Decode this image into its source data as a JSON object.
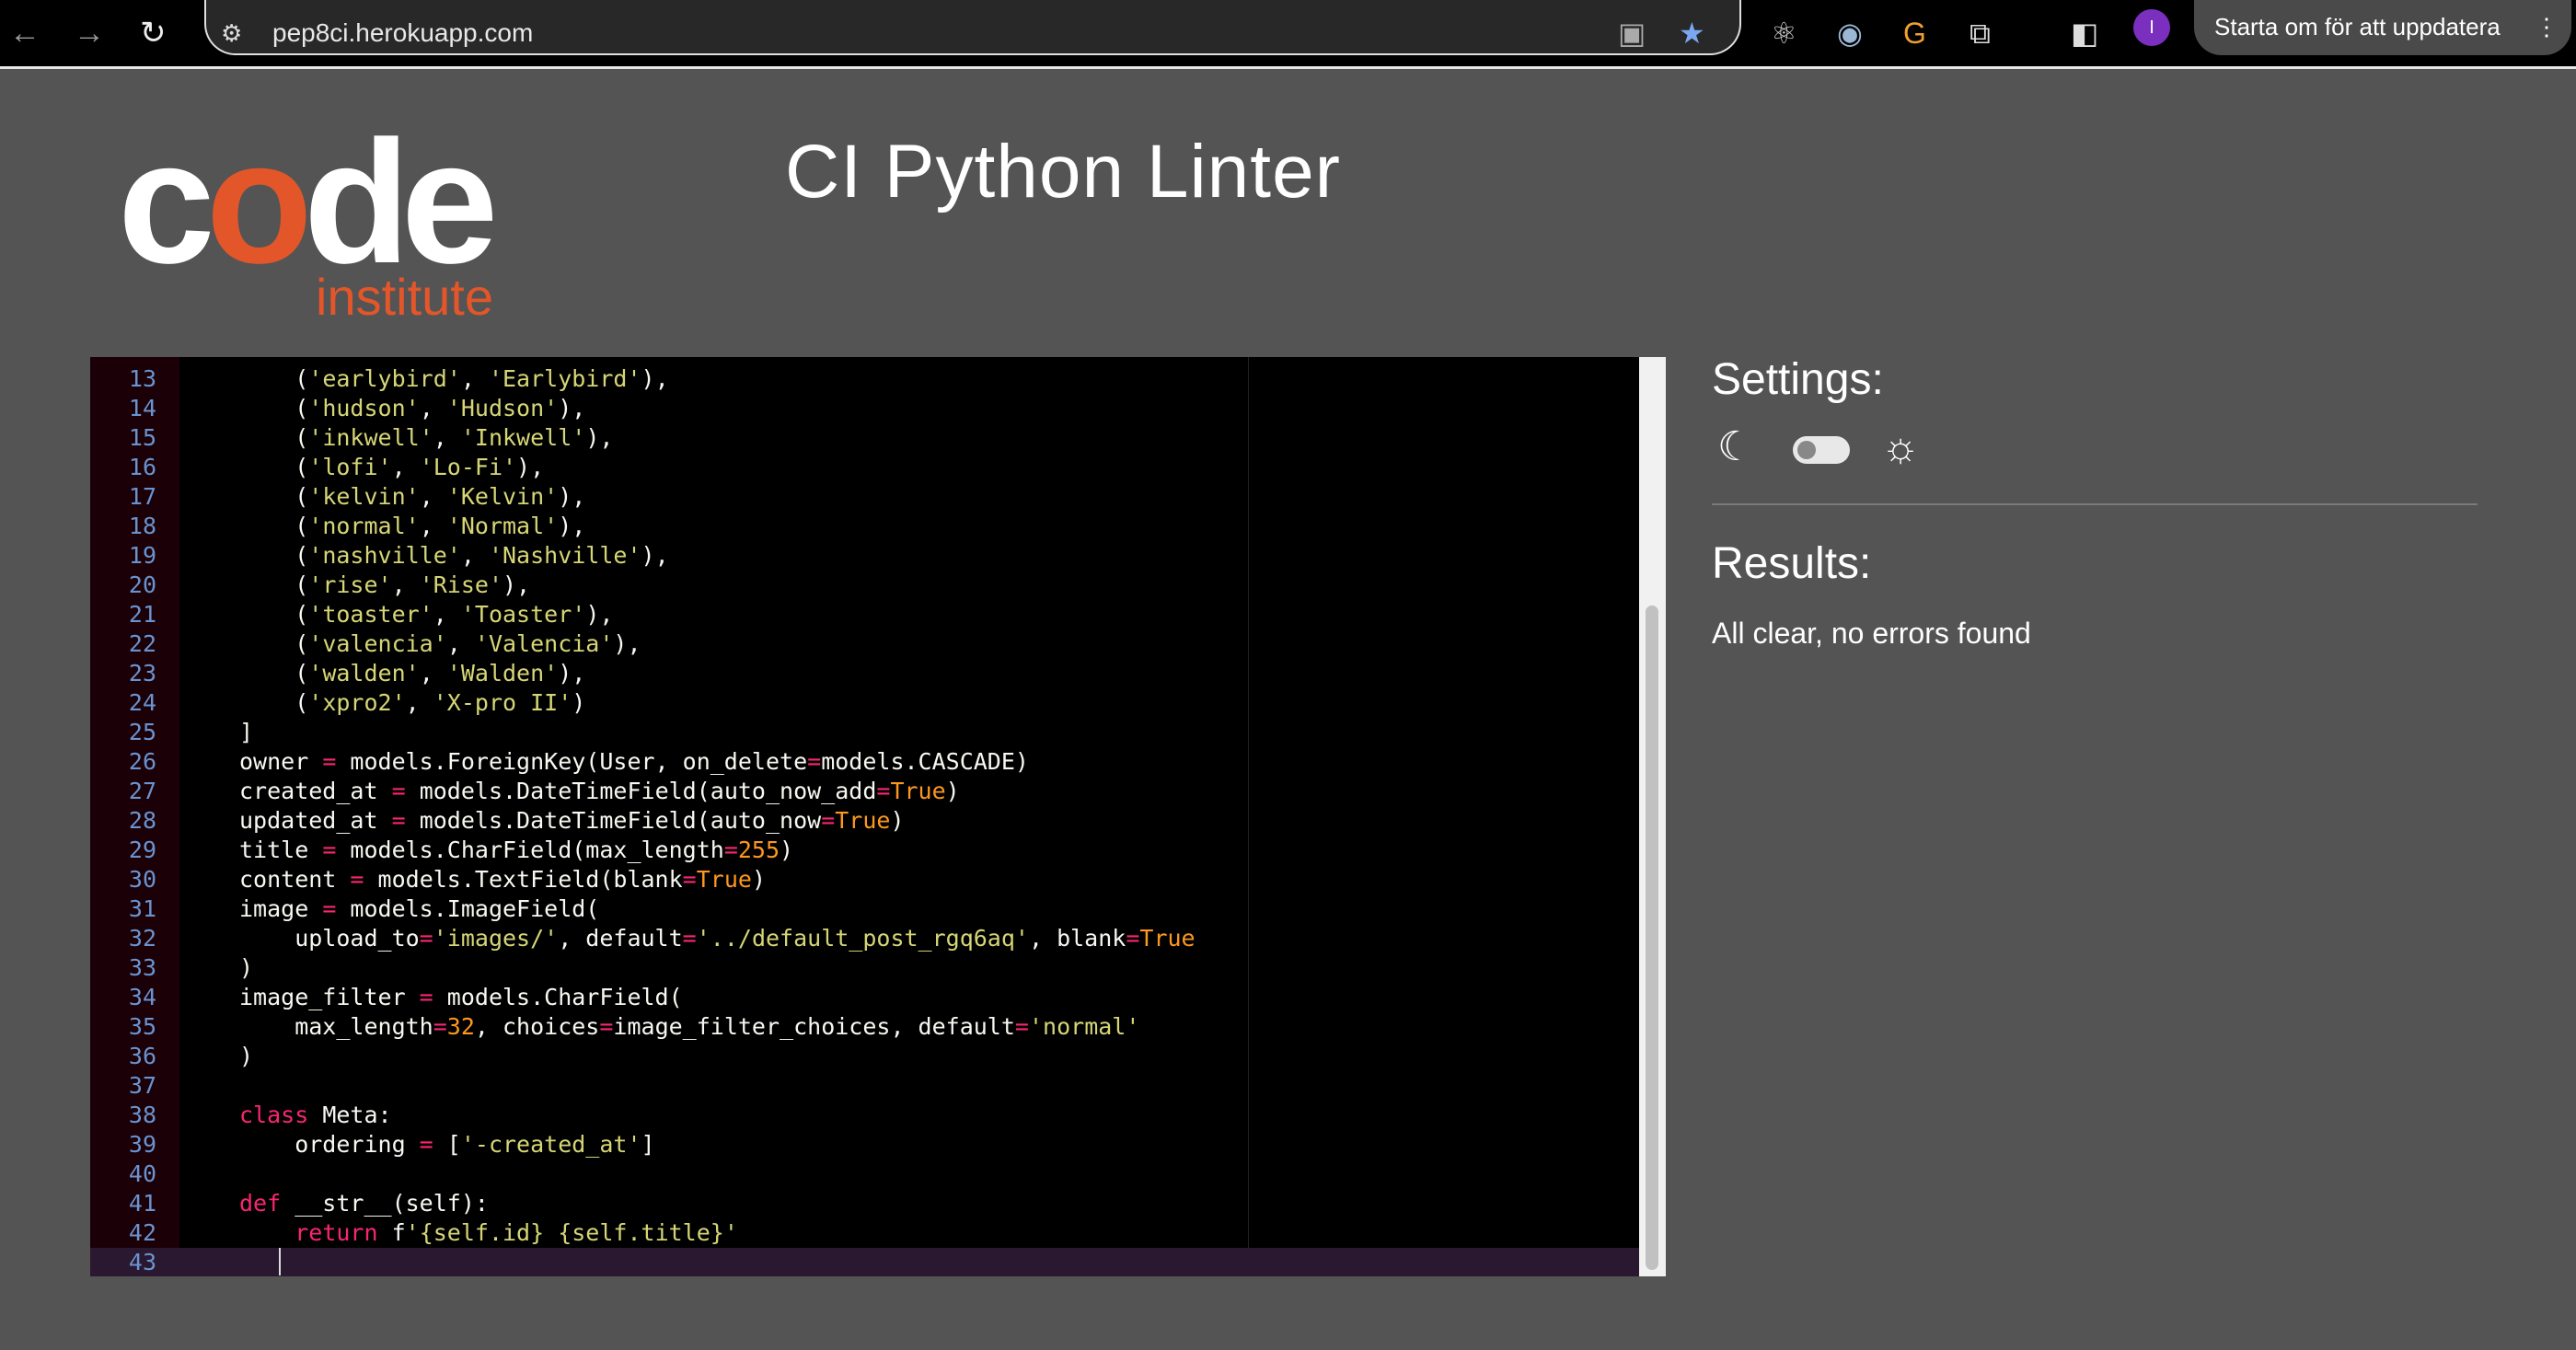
{
  "browser": {
    "url": "pep8ci.herokuapp.com",
    "restart_label": "Starta om för att uppdatera",
    "profile_initial": "I",
    "icons": [
      "back-icon",
      "forward-icon",
      "reload-icon",
      "site-settings-icon",
      "translate-icon",
      "bookmark-star-icon",
      "react-devtools-icon",
      "extension-icon",
      "extension-icon",
      "extensions-puzzle-icon",
      "side-panel-icon",
      "profile-avatar",
      "menu-icon"
    ]
  },
  "logo": {
    "word": "code",
    "sub": "institute",
    "accent": "#e3562a"
  },
  "header": {
    "title": "CI Python Linter"
  },
  "editor": {
    "active_line": 43,
    "lines": [
      {
        "n": "13",
        "t": [
          [
            "p",
            "    ("
          ],
          [
            "str",
            "'earlybird'"
          ],
          [
            "p",
            ", "
          ],
          [
            "str",
            "'Earlybird'"
          ],
          [
            "p",
            "),"
          ]
        ]
      },
      {
        "n": "14",
        "t": [
          [
            "p",
            "    ("
          ],
          [
            "str",
            "'hudson'"
          ],
          [
            "p",
            ", "
          ],
          [
            "str",
            "'Hudson'"
          ],
          [
            "p",
            "),"
          ]
        ]
      },
      {
        "n": "15",
        "t": [
          [
            "p",
            "    ("
          ],
          [
            "str",
            "'inkwell'"
          ],
          [
            "p",
            ", "
          ],
          [
            "str",
            "'Inkwell'"
          ],
          [
            "p",
            "),"
          ]
        ]
      },
      {
        "n": "16",
        "t": [
          [
            "p",
            "    ("
          ],
          [
            "str",
            "'lofi'"
          ],
          [
            "p",
            ", "
          ],
          [
            "str",
            "'Lo-Fi'"
          ],
          [
            "p",
            "),"
          ]
        ]
      },
      {
        "n": "17",
        "t": [
          [
            "p",
            "    ("
          ],
          [
            "str",
            "'kelvin'"
          ],
          [
            "p",
            ", "
          ],
          [
            "str",
            "'Kelvin'"
          ],
          [
            "p",
            "),"
          ]
        ]
      },
      {
        "n": "18",
        "t": [
          [
            "p",
            "    ("
          ],
          [
            "str",
            "'normal'"
          ],
          [
            "p",
            ", "
          ],
          [
            "str",
            "'Normal'"
          ],
          [
            "p",
            "),"
          ]
        ]
      },
      {
        "n": "19",
        "t": [
          [
            "p",
            "    ("
          ],
          [
            "str",
            "'nashville'"
          ],
          [
            "p",
            ", "
          ],
          [
            "str",
            "'Nashville'"
          ],
          [
            "p",
            "),"
          ]
        ]
      },
      {
        "n": "20",
        "t": [
          [
            "p",
            "    ("
          ],
          [
            "str",
            "'rise'"
          ],
          [
            "p",
            ", "
          ],
          [
            "str",
            "'Rise'"
          ],
          [
            "p",
            "),"
          ]
        ]
      },
      {
        "n": "21",
        "t": [
          [
            "p",
            "    ("
          ],
          [
            "str",
            "'toaster'"
          ],
          [
            "p",
            ", "
          ],
          [
            "str",
            "'Toaster'"
          ],
          [
            "p",
            "),"
          ]
        ]
      },
      {
        "n": "22",
        "t": [
          [
            "p",
            "    ("
          ],
          [
            "str",
            "'valencia'"
          ],
          [
            "p",
            ", "
          ],
          [
            "str",
            "'Valencia'"
          ],
          [
            "p",
            "),"
          ]
        ]
      },
      {
        "n": "23",
        "t": [
          [
            "p",
            "    ("
          ],
          [
            "str",
            "'walden'"
          ],
          [
            "p",
            ", "
          ],
          [
            "str",
            "'Walden'"
          ],
          [
            "p",
            "),"
          ]
        ]
      },
      {
        "n": "24",
        "t": [
          [
            "p",
            "    ("
          ],
          [
            "str",
            "'xpro2'"
          ],
          [
            "p",
            ", "
          ],
          [
            "str",
            "'X-pro II'"
          ],
          [
            "p",
            ")"
          ]
        ]
      },
      {
        "n": "25",
        "t": [
          [
            "p",
            "]"
          ]
        ]
      },
      {
        "n": "26",
        "t": [
          [
            "p",
            "owner "
          ],
          [
            "op",
            "="
          ],
          [
            "p",
            " models.ForeignKey(User, on_delete"
          ],
          [
            "op",
            "="
          ],
          [
            "p",
            "models.CASCADE)"
          ]
        ]
      },
      {
        "n": "27",
        "t": [
          [
            "p",
            "created_at "
          ],
          [
            "op",
            "="
          ],
          [
            "p",
            " models.DateTimeField(auto_now_add"
          ],
          [
            "op",
            "="
          ],
          [
            "bool",
            "True"
          ],
          [
            "p",
            ")"
          ]
        ]
      },
      {
        "n": "28",
        "t": [
          [
            "p",
            "updated_at "
          ],
          [
            "op",
            "="
          ],
          [
            "p",
            " models.DateTimeField(auto_now"
          ],
          [
            "op",
            "="
          ],
          [
            "bool",
            "True"
          ],
          [
            "p",
            ")"
          ]
        ]
      },
      {
        "n": "29",
        "t": [
          [
            "p",
            "title "
          ],
          [
            "op",
            "="
          ],
          [
            "p",
            " models.CharField(max_length"
          ],
          [
            "op",
            "="
          ],
          [
            "bool",
            "255"
          ],
          [
            "p",
            ")"
          ]
        ]
      },
      {
        "n": "30",
        "t": [
          [
            "p",
            "content "
          ],
          [
            "op",
            "="
          ],
          [
            "p",
            " models.TextField(blank"
          ],
          [
            "op",
            "="
          ],
          [
            "bool",
            "True"
          ],
          [
            "p",
            ")"
          ]
        ]
      },
      {
        "n": "31",
        "t": [
          [
            "p",
            "image "
          ],
          [
            "op",
            "="
          ],
          [
            "p",
            " models.ImageField("
          ]
        ]
      },
      {
        "n": "32",
        "t": [
          [
            "p",
            "    upload_to"
          ],
          [
            "op",
            "="
          ],
          [
            "str",
            "'images/'"
          ],
          [
            "p",
            ", default"
          ],
          [
            "op",
            "="
          ],
          [
            "str",
            "'../default_post_rgq6aq'"
          ],
          [
            "p",
            ", blank"
          ],
          [
            "op",
            "="
          ],
          [
            "bool",
            "True"
          ]
        ]
      },
      {
        "n": "33",
        "t": [
          [
            "p",
            ")"
          ]
        ]
      },
      {
        "n": "34",
        "t": [
          [
            "p",
            "image_filter "
          ],
          [
            "op",
            "="
          ],
          [
            "p",
            " models.CharField("
          ]
        ]
      },
      {
        "n": "35",
        "t": [
          [
            "p",
            "    max_length"
          ],
          [
            "op",
            "="
          ],
          [
            "bool",
            "32"
          ],
          [
            "p",
            ", choices"
          ],
          [
            "op",
            "="
          ],
          [
            "p",
            "image_filter_choices, default"
          ],
          [
            "op",
            "="
          ],
          [
            "str",
            "'normal'"
          ]
        ]
      },
      {
        "n": "36",
        "t": [
          [
            "p",
            ")"
          ]
        ]
      },
      {
        "n": "37",
        "t": []
      },
      {
        "n": "38",
        "t": [
          [
            "kw",
            "class"
          ],
          [
            "p",
            " Meta:"
          ]
        ]
      },
      {
        "n": "39",
        "t": [
          [
            "p",
            "    ordering "
          ],
          [
            "op",
            "="
          ],
          [
            "p",
            " ["
          ],
          [
            "str",
            "'-created_at'"
          ],
          [
            "p",
            "]"
          ]
        ]
      },
      {
        "n": "40",
        "t": []
      },
      {
        "n": "41",
        "t": [
          [
            "kw",
            "def"
          ],
          [
            "p",
            " __str__(self):"
          ]
        ]
      },
      {
        "n": "42",
        "t": [
          [
            "p",
            "    "
          ],
          [
            "kw",
            "return"
          ],
          [
            "p",
            " f"
          ],
          [
            "str",
            "'{self.id} {self.title}'"
          ]
        ]
      },
      {
        "n": "43",
        "t": []
      }
    ]
  },
  "settings": {
    "heading": "Settings:",
    "theme_toggle_on": false
  },
  "results": {
    "heading": "Results:",
    "status": "All clear, no errors found"
  }
}
